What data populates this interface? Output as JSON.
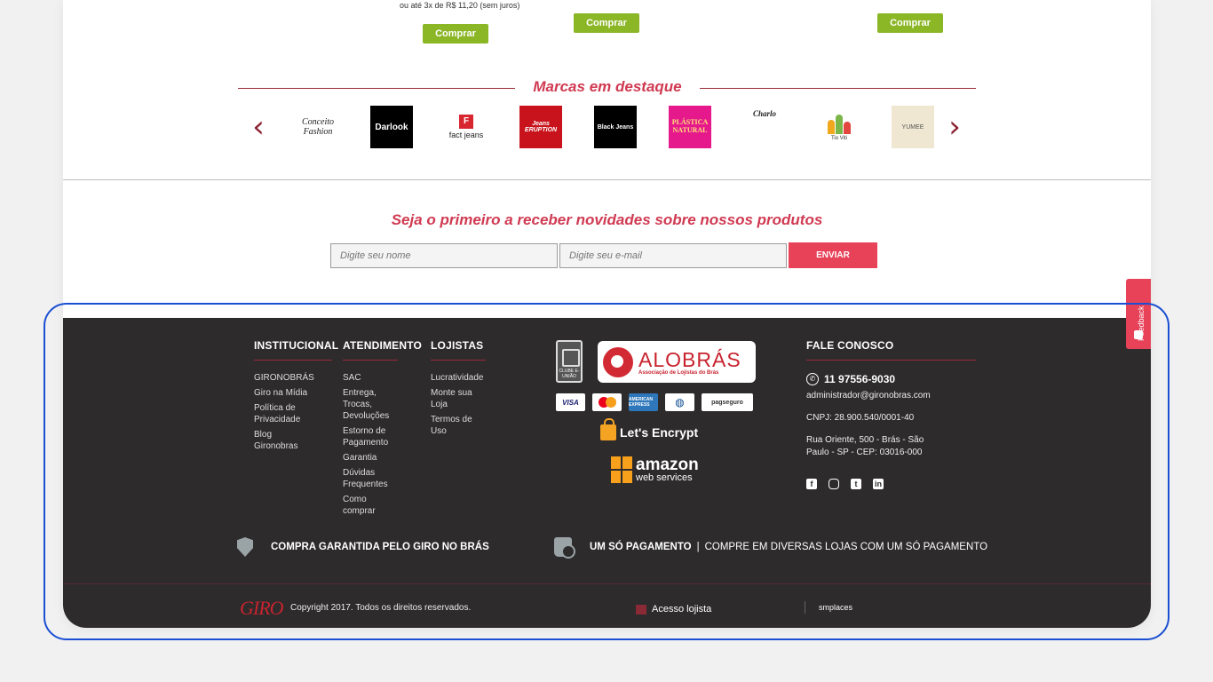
{
  "products": {
    "installment_text": "ou até 3x de R$ 11,20 (sem juros)",
    "buy_label": "Comprar"
  },
  "brands": {
    "title": "Marcas em destaque",
    "prev_icon": "chevron-left-icon",
    "next_icon": "chevron-right-icon",
    "logos": [
      {
        "name": "Conceito Fashion",
        "text": "Conceito Fashion"
      },
      {
        "name": "Darlook",
        "text": "Darlook"
      },
      {
        "name": "Fact Jeans",
        "text": "fact jeans",
        "badge": "F"
      },
      {
        "name": "Eruption",
        "text": "Jeans ERUPTION"
      },
      {
        "name": "Black Jeans",
        "text": "Black Jeans"
      },
      {
        "name": "Plástica Natural",
        "text": "PLÁSTICA NATURAL"
      },
      {
        "name": "Charlo",
        "text": "Charlo"
      },
      {
        "name": "Tio Viti",
        "text": "Tio Viti"
      },
      {
        "name": "Yumee",
        "text": "YUMEE"
      }
    ]
  },
  "newsletter": {
    "title": "Seja o primeiro a receber novidades sobre nossos produtos",
    "name_placeholder": "Digite seu nome",
    "email_placeholder": "Digite seu e-mail",
    "submit_label": "ENVIAR"
  },
  "footer": {
    "institucional": {
      "title": "INSTITUCIONAL",
      "items": [
        "GIRONOBRÁS",
        "Giro na Mídia",
        "Política de Privacidade",
        "Blog Gironobras"
      ]
    },
    "atendimento": {
      "title": "ATENDIMENTO",
      "items": [
        "SAC",
        "Entrega, Trocas, Devoluções",
        "Estorno de Pagamento",
        "Garantia",
        "Dúvidas Frequentes",
        "Como comprar"
      ]
    },
    "lojistas": {
      "title": "LOJISTAS",
      "items": [
        "Lucratividade",
        "Monte sua Loja",
        "Termos de Uso"
      ]
    },
    "seals": {
      "seal_text": "CLUBE E-UNIÃO",
      "alobras_name": "ALOBRÁS",
      "alobras_sub": "Associação de Lojistas do Brás",
      "cards": [
        "VISA",
        "MasterCard",
        "AMERICAN EXPRESS",
        "Diners",
        "pagseguro"
      ],
      "letsencrypt": "Let's Encrypt",
      "aws_line1": "amazon",
      "aws_line2": "web services"
    },
    "contact": {
      "title": "FALE CONOSCO",
      "phone": "11 97556-9030",
      "email": "administrador@gironobras.com",
      "cnpj": "CNPJ: 28.900.540/0001-40",
      "address": "Rua Oriente, 500 - Brás - São Paulo - SP - CEP: 03016-000",
      "socials": [
        "facebook-icon",
        "instagram-icon",
        "twitter-icon",
        "linkedin-icon"
      ]
    },
    "guarantee_text": "COMPRA GARANTIDA PELO GIRO NO BRÁS",
    "one_payment_bold": "UM SÓ PAGAMENTO",
    "one_payment_sep": "|",
    "one_payment_text": "COMPRE EM DIVERSAS LOJAS COM UM SÓ PAGAMENTO",
    "giro_logo": "GIRO",
    "copyright": "Copyright 2017. Todos os direitos reservados.",
    "acesso_lojista": "Acesso lojista",
    "smplaces": "smplaces"
  },
  "feedback_label": "Feedback",
  "colors": {
    "accent": "#d03a52",
    "buy_green": "#8bb626",
    "footer_bg": "#2d2b2c",
    "highlight": "#1a4fd3"
  }
}
